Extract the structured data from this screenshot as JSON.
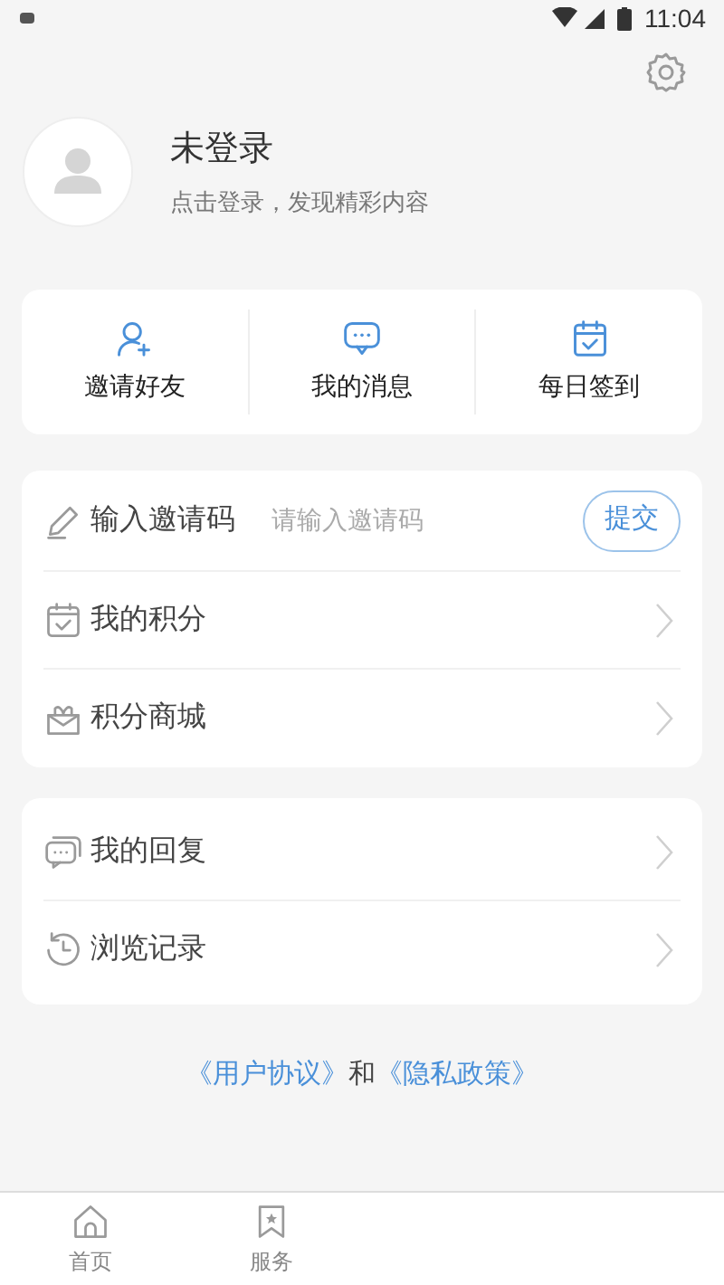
{
  "status_bar": {
    "time": "11:04"
  },
  "profile": {
    "name": "未登录",
    "subtitle": "点击登录，发现精彩内容"
  },
  "quick_actions": [
    {
      "kind": "invite",
      "label": "邀请好友"
    },
    {
      "kind": "messages",
      "label": "我的消息"
    },
    {
      "kind": "checkin",
      "label": "每日签到"
    }
  ],
  "invite_code": {
    "label": "输入邀请码",
    "placeholder": "请输入邀请码",
    "button": "提交"
  },
  "menu_groups": [
    [
      {
        "kind": "points",
        "label": "我的积分"
      },
      {
        "kind": "mall",
        "label": "积分商城"
      }
    ],
    [
      {
        "kind": "replies",
        "label": "我的回复"
      },
      {
        "kind": "history",
        "label": "浏览记录"
      }
    ]
  ],
  "agreement": {
    "user_agreement": "《用户协议》",
    "joiner": "和",
    "privacy_policy": "《隐私政策》"
  },
  "bottom_nav": [
    {
      "kind": "home",
      "label": "首页"
    },
    {
      "kind": "service",
      "label": "服务"
    }
  ]
}
